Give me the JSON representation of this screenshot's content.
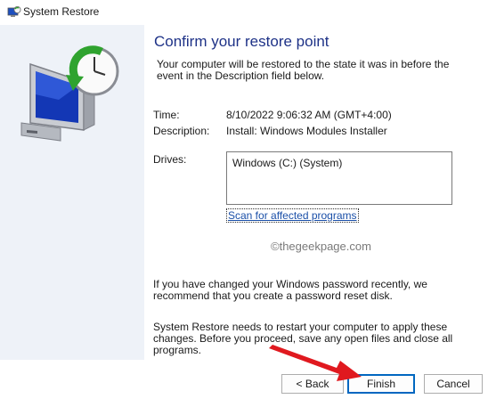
{
  "window": {
    "title": "System Restore"
  },
  "heading": "Confirm your restore point",
  "intro": "Your computer will be restored to the state it was in before the event in the Description field below.",
  "details": {
    "time_label": "Time:",
    "time_value": "8/10/2022 9:06:32 AM (GMT+4:00)",
    "description_label": "Description:",
    "description_value": "Install: Windows Modules Installer",
    "drives_label": "Drives:",
    "drives_value": "Windows (C:) (System)"
  },
  "scan_link": "Scan for affected programs",
  "watermark": "©thegeekpage.com",
  "password_note": "If you have changed your Windows password recently, we recommend that you create a password reset disk.",
  "restart_note": "System Restore needs to restart your computer to apply these changes. Before you proceed, save any open files and close all programs.",
  "buttons": {
    "back": "< Back",
    "finish": "Finish",
    "cancel": "Cancel"
  },
  "icons": {
    "app": "system-restore-icon",
    "hero": "restore-monitor-clock-icon",
    "annotation": "red-arrow-icon"
  },
  "colors": {
    "heading": "#1e3287",
    "link": "#1a4fa8",
    "left_panel": "#eef2f8",
    "accent": "#0067c0",
    "annotation": "#e0191f"
  }
}
